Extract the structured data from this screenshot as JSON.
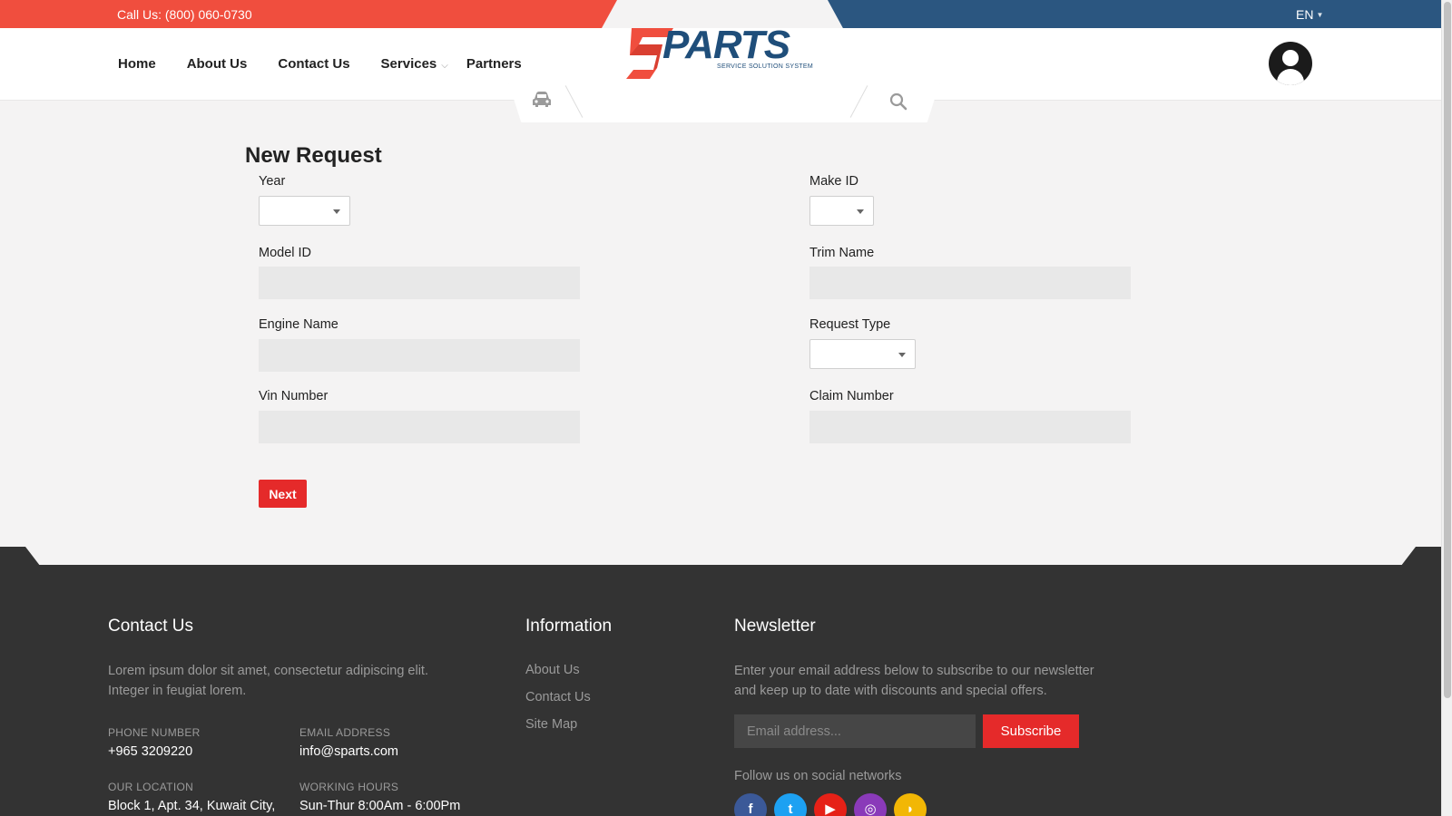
{
  "topbar": {
    "phone": "Call Us: (800) 060-0730",
    "lang": "EN"
  },
  "nav": {
    "items": [
      {
        "label": "Home"
      },
      {
        "label": "About Us"
      },
      {
        "label": "Contact Us"
      },
      {
        "label": "Services",
        "has_dropdown": true
      },
      {
        "label": "Partners"
      }
    ]
  },
  "logo": {
    "text": "PARTS",
    "subtitle": "SERVICE SOLUTION SYSTEM",
    "accent": "#f04e3e",
    "brand": "#1f4e7a"
  },
  "search": {
    "placeholder": ""
  },
  "form": {
    "title": "New Request",
    "year_label": "Year",
    "make_label": "Make ID",
    "model_label": "Model ID",
    "trim_label": "Trim Name",
    "engine_label": "Engine Name",
    "request_type_label": "Request Type",
    "vin_label": "Vin Number",
    "claim_label": "Claim Number",
    "next_label": "Next"
  },
  "footer": {
    "contact_title": "Contact Us",
    "contact_text_1": "Lorem ipsum dolor sit amet, consectetur adipiscing elit.",
    "contact_text_2": "Integer in feugiat lorem.",
    "phone_caption": "PHONE NUMBER",
    "phone_value": "+965 3209220",
    "email_caption": "EMAIL ADDRESS",
    "email_value": "info@sparts.com",
    "location_caption": "OUR LOCATION",
    "location_value": "Block 1, Apt. 34, Kuwait City,",
    "hours_caption": "WORKING HOURS",
    "hours_value": "Sun-Thur 8:00Am - 6:00Pm",
    "info_title": "Information",
    "info_links": [
      "About Us",
      "Contact Us",
      "Site Map"
    ],
    "newsletter_title": "Newsletter",
    "newsletter_text_1": "Enter your email address below to subscribe to our newsletter",
    "newsletter_text_2": "and keep up to date with discounts and special offers.",
    "email_placeholder": "Email address...",
    "subscribe_label": "Subscribe",
    "follow_label": "Follow us on social networks",
    "social": [
      {
        "icon": "facebook-icon",
        "glyph": "f",
        "color": "#3b5998"
      },
      {
        "icon": "twitter-icon",
        "glyph": "t",
        "color": "#1da1f2"
      },
      {
        "icon": "youtube-icon",
        "glyph": "▶",
        "color": "#e62117"
      },
      {
        "icon": "instagram-icon",
        "glyph": "◎",
        "color": "#8a3ab9"
      },
      {
        "icon": "rss-icon",
        "glyph": "◗",
        "color": "#f2b705"
      }
    ]
  }
}
